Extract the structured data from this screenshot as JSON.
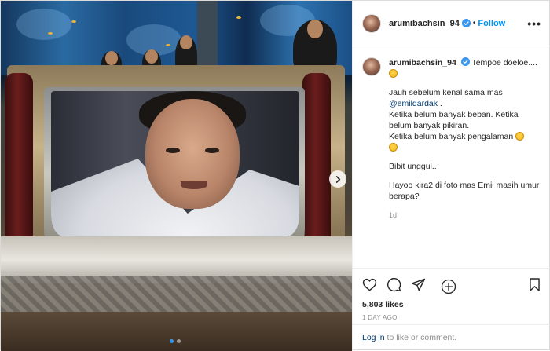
{
  "post": {
    "media": {
      "slide_count": 2,
      "active_slide": 1,
      "next_icon": "chevron-right-icon"
    },
    "header": {
      "username": "arumibachsin_94",
      "verified_icon": "verified-badge-icon",
      "separator": "•",
      "follow_label": "Follow",
      "more_label": "•••"
    },
    "caption": {
      "username": "arumibachsin_94",
      "title_text": "Tempoe doeloe....",
      "lines_1": [
        "Jauh sebelum kenal sama mas"
      ],
      "mention": "@emildardak",
      "mention_suffix": " .",
      "lines_2": [
        "Ketika belum banyak beban. Ketika belum banyak pikiran.",
        "Ketika belum banyak pengalaman"
      ],
      "para_3": "Bibit unggul..",
      "para_4": "Hayoo kira2 di foto mas Emil masih umur berapa?",
      "time_ago": "1d"
    },
    "actions": {
      "like_icon": "heart-icon",
      "comment_icon": "comment-icon",
      "share_icon": "share-icon",
      "save_icon": "bookmark-icon",
      "likes_text": "5,803 likes",
      "date_text": "1 DAY AGO"
    },
    "login": {
      "link_text": "Log in",
      "rest_text": " to like or comment."
    }
  },
  "colors": {
    "accent": "#0095f6",
    "link": "#00376b",
    "muted": "#8e8e8e",
    "text": "#262626"
  }
}
